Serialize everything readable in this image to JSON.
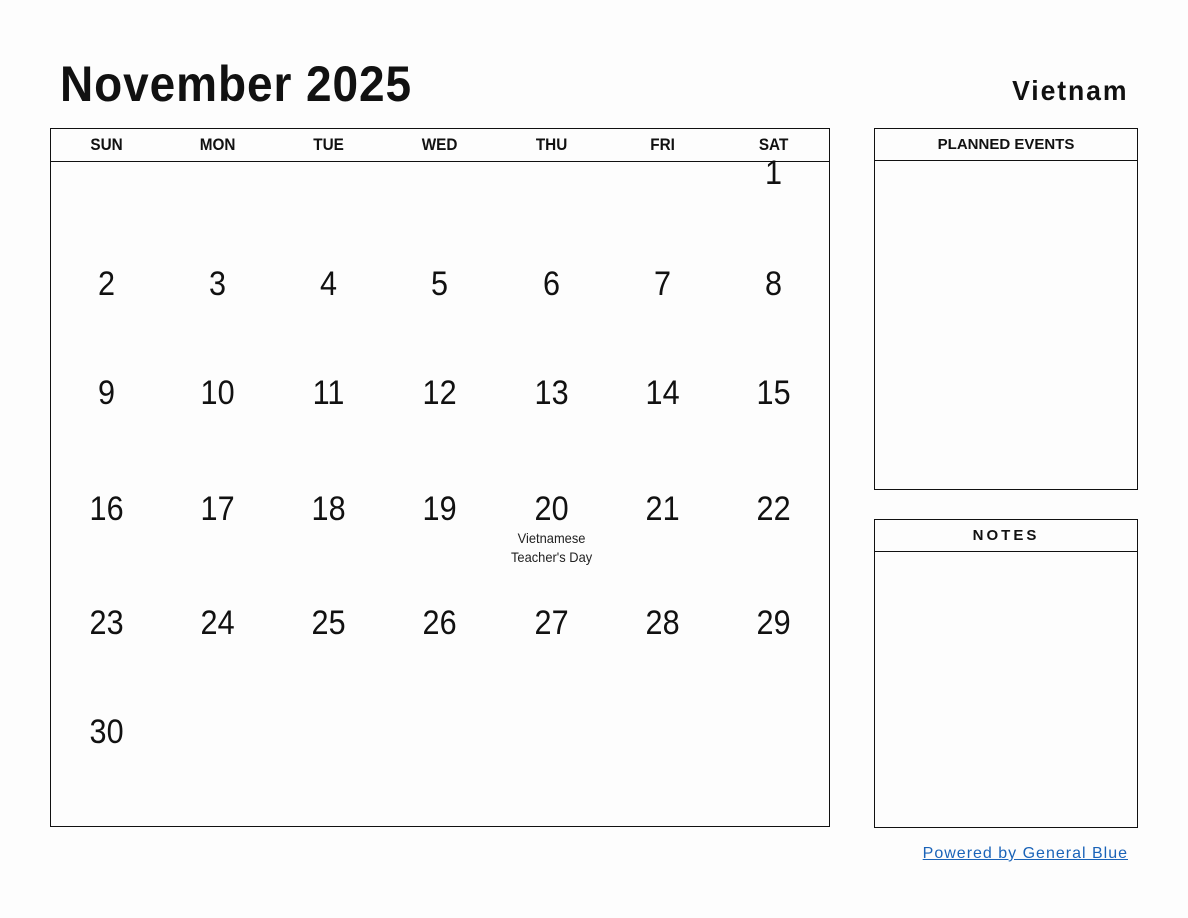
{
  "header": {
    "title": "November 2025",
    "country": "Vietnam"
  },
  "calendar": {
    "weekdays": [
      "SUN",
      "MON",
      "TUE",
      "WED",
      "THU",
      "FRI",
      "SAT"
    ],
    "weeks": [
      [
        {
          "day": ""
        },
        {
          "day": ""
        },
        {
          "day": ""
        },
        {
          "day": ""
        },
        {
          "day": ""
        },
        {
          "day": ""
        },
        {
          "day": "1"
        }
      ],
      [
        {
          "day": "2"
        },
        {
          "day": "3"
        },
        {
          "day": "4"
        },
        {
          "day": "5"
        },
        {
          "day": "6"
        },
        {
          "day": "7"
        },
        {
          "day": "8"
        }
      ],
      [
        {
          "day": "9"
        },
        {
          "day": "10"
        },
        {
          "day": "11"
        },
        {
          "day": "12"
        },
        {
          "day": "13"
        },
        {
          "day": "14"
        },
        {
          "day": "15"
        }
      ],
      [
        {
          "day": "16"
        },
        {
          "day": "17"
        },
        {
          "day": "18"
        },
        {
          "day": "19"
        },
        {
          "day": "20",
          "event": [
            "Vietnamese",
            "Teacher's Day"
          ]
        },
        {
          "day": "21"
        },
        {
          "day": "22"
        }
      ],
      [
        {
          "day": "23"
        },
        {
          "day": "24"
        },
        {
          "day": "25"
        },
        {
          "day": "26"
        },
        {
          "day": "27"
        },
        {
          "day": "28"
        },
        {
          "day": "29"
        }
      ],
      [
        {
          "day": "30"
        },
        {
          "day": ""
        },
        {
          "day": ""
        },
        {
          "day": ""
        },
        {
          "day": ""
        },
        {
          "day": ""
        },
        {
          "day": ""
        }
      ]
    ]
  },
  "panels": {
    "planned_events_label": "PLANNED EVENTS",
    "notes_label": "NOTES"
  },
  "footer": {
    "powered_by": "Powered by General Blue",
    "link_color": "#1a63b8"
  }
}
